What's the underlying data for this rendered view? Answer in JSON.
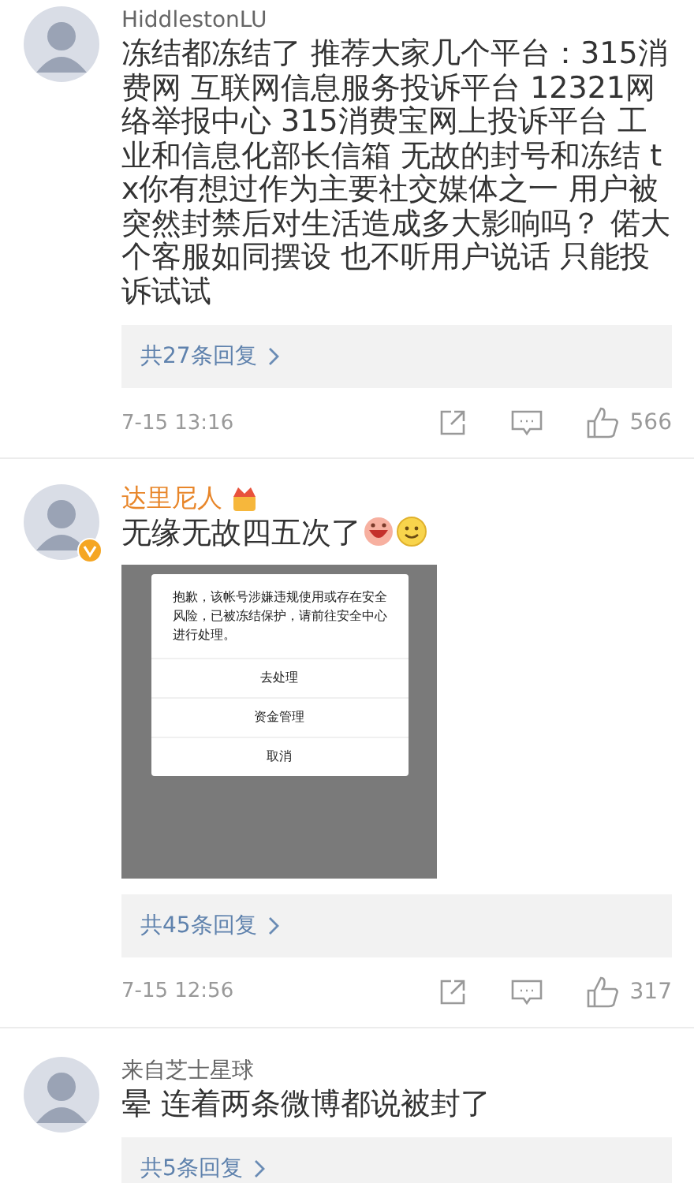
{
  "comments": [
    {
      "author": "HiddlestonLU",
      "vip": false,
      "verified": false,
      "text": "冻结都冻结了  推荐大家几个平台：315消费网  互联网信息服务投诉平台  12321网络举报中心 315消费宝网上投诉平台 工业和信息化部长信箱  无故的封号和冻结 tx你有想过作为主要社交媒体之一 用户被突然封禁后对生活造成多大影响吗？ 偌大个客服如同摆设 也不听用户说话 只能投诉试试",
      "trailing_emoji": false,
      "replies": "共27条回复",
      "time": "7-15 13:16",
      "likes": "566"
    },
    {
      "author": "达里尼人",
      "vip": true,
      "verified": true,
      "text": "无缘无故四五次了",
      "trailing_emoji": true,
      "screenshot": {
        "message": "抱歉，该帐号涉嫌违规使用或存在安全风险，已被冻结保护，请前往安全中心进行处理。",
        "buttons": [
          "去处理",
          "资金管理",
          "取消"
        ]
      },
      "replies": "共45条回复",
      "time": "7-15 12:56",
      "likes": "317"
    },
    {
      "author": "来自芝士星球",
      "vip": false,
      "verified": false,
      "text": "晕 连着两条微博都说被封了",
      "trailing_emoji": false,
      "replies": "共5条回复"
    }
  ]
}
